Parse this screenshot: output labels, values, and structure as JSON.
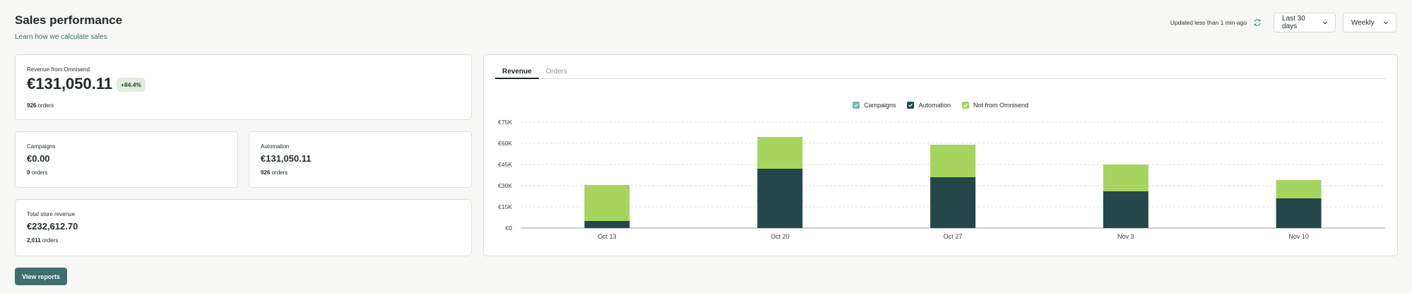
{
  "header": {
    "title": "Sales performance",
    "learn_link": "Learn how we calculate sales",
    "updated": "Updated less than 1 min ago",
    "period": "Last 30 days",
    "granularity": "Weekly"
  },
  "revenue_card": {
    "label": "Revenue from Omnisend",
    "value": "€131,050.11",
    "badge": "+84.4%",
    "orders_count": "926",
    "orders_label": "orders"
  },
  "campaigns_card": {
    "label": "Campaigns",
    "value": "€0.00",
    "orders_count": "0",
    "orders_label": "orders"
  },
  "automation_card": {
    "label": "Automation",
    "value": "€131,050.11",
    "orders_count": "926",
    "orders_label": "orders"
  },
  "total_card": {
    "label": "Total store revenue",
    "value": "€232,612.70",
    "orders_count": "2,011",
    "orders_label": "orders"
  },
  "view_reports": "View reports",
  "tabs": [
    {
      "label": "Revenue",
      "active": true
    },
    {
      "label": "Orders",
      "active": false
    }
  ],
  "colors": {
    "campaigns": "#7fb2b0",
    "automation": "#24484a",
    "not_from_omnisend": "#a5d55f",
    "accent": "#3f6e6d"
  },
  "chart_data": {
    "type": "bar",
    "stacked": true,
    "categories": [
      "Oct 13",
      "Oct 20",
      "Oct 27",
      "Nov 3",
      "Nov 10"
    ],
    "series": [
      {
        "name": "Campaigns",
        "color": "#7fb2b0",
        "values": [
          0,
          0,
          0,
          0,
          0
        ]
      },
      {
        "name": "Automation",
        "color": "#24484a",
        "values": [
          5000,
          42000,
          36000,
          26000,
          21000
        ]
      },
      {
        "name": "Not from Omnisend",
        "color": "#a5d55f",
        "values": [
          25500,
          22500,
          23000,
          19000,
          13000
        ]
      }
    ],
    "ylim": [
      0,
      75000
    ],
    "yticks": [
      "€0",
      "€15K",
      "€30K",
      "€45K",
      "€60K",
      "€75K"
    ],
    "ytick_values": [
      0,
      15000,
      30000,
      45000,
      60000,
      75000
    ],
    "grid": true,
    "legend": "top-center"
  }
}
